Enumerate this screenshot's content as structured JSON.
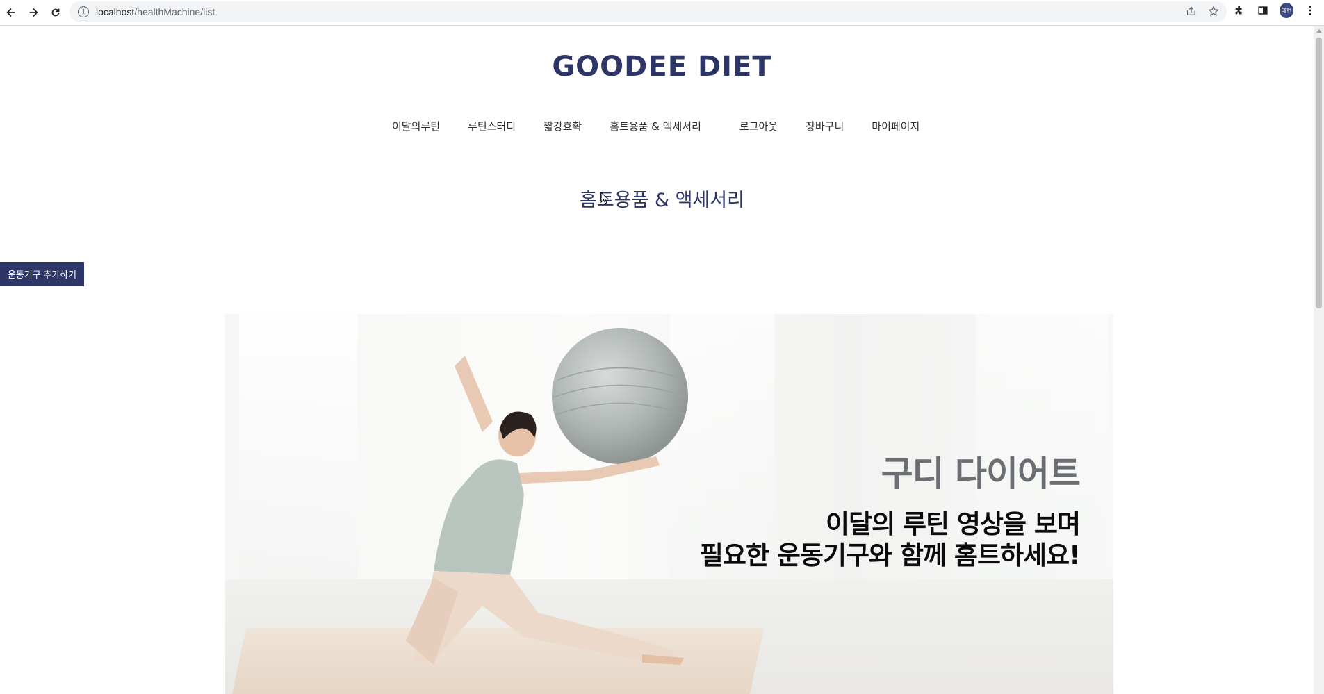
{
  "browser": {
    "url_host": "localhost",
    "url_path": "/healthMachine/list",
    "avatar_text": "태현"
  },
  "site": {
    "title": "GOODEE DIET"
  },
  "nav": {
    "items": [
      {
        "label": "이달의루틴"
      },
      {
        "label": "루틴스터디"
      },
      {
        "label": "짧강효확"
      },
      {
        "label": "홈트용품 & 액세서리"
      },
      {
        "label": "로그아웃"
      },
      {
        "label": "장바구니"
      },
      {
        "label": "마이페이지"
      }
    ]
  },
  "section": {
    "title": "홈트용품 & 액세서리"
  },
  "actions": {
    "add_equipment": "운동기구 추가하기"
  },
  "hero": {
    "heading": "구디 다이어트",
    "line1": "이달의 루틴 영상을 보며",
    "line2": "필요한 운동기구와 함께 홈트하세요!"
  },
  "colors": {
    "brand": "#2d3667"
  }
}
